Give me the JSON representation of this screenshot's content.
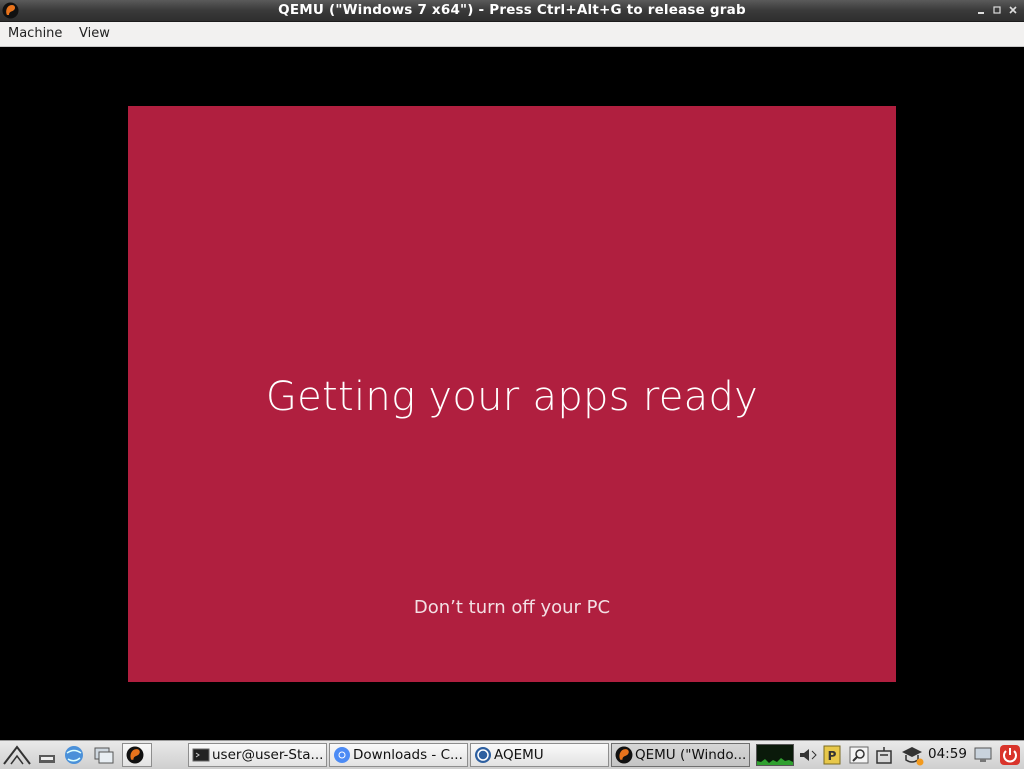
{
  "window": {
    "title": "QEMU (\"Windows 7 x64\") - Press Ctrl+Alt+G to release grab",
    "icon": "qemu-icon",
    "buttons": [
      "minimize",
      "restore",
      "close"
    ]
  },
  "menubar": {
    "items": [
      "Machine",
      "View"
    ]
  },
  "vm_screen": {
    "background": "#b01f3f",
    "heading": "Getting your apps ready",
    "subtext": "Don’t turn off your PC"
  },
  "taskbar": {
    "launchers": [
      "start-menu-icon",
      "show-desktop-icon",
      "browser-icon",
      "file-manager-icon",
      "qemu-launcher-icon"
    ],
    "tasks": [
      {
        "label": "user@user-Sta...",
        "icon": "terminal-icon"
      },
      {
        "label": "Downloads - C...",
        "icon": "chromium-icon"
      },
      {
        "label": "AQEMU",
        "icon": "aqemu-icon"
      },
      {
        "label": "QEMU (\"Windo...",
        "icon": "qemu-icon",
        "active": true
      }
    ],
    "tray": [
      "cpu-monitor",
      "volume-icon",
      "clipboard-icon",
      "search-icon",
      "network-icon",
      "update-icon"
    ],
    "clock": "04:59"
  }
}
